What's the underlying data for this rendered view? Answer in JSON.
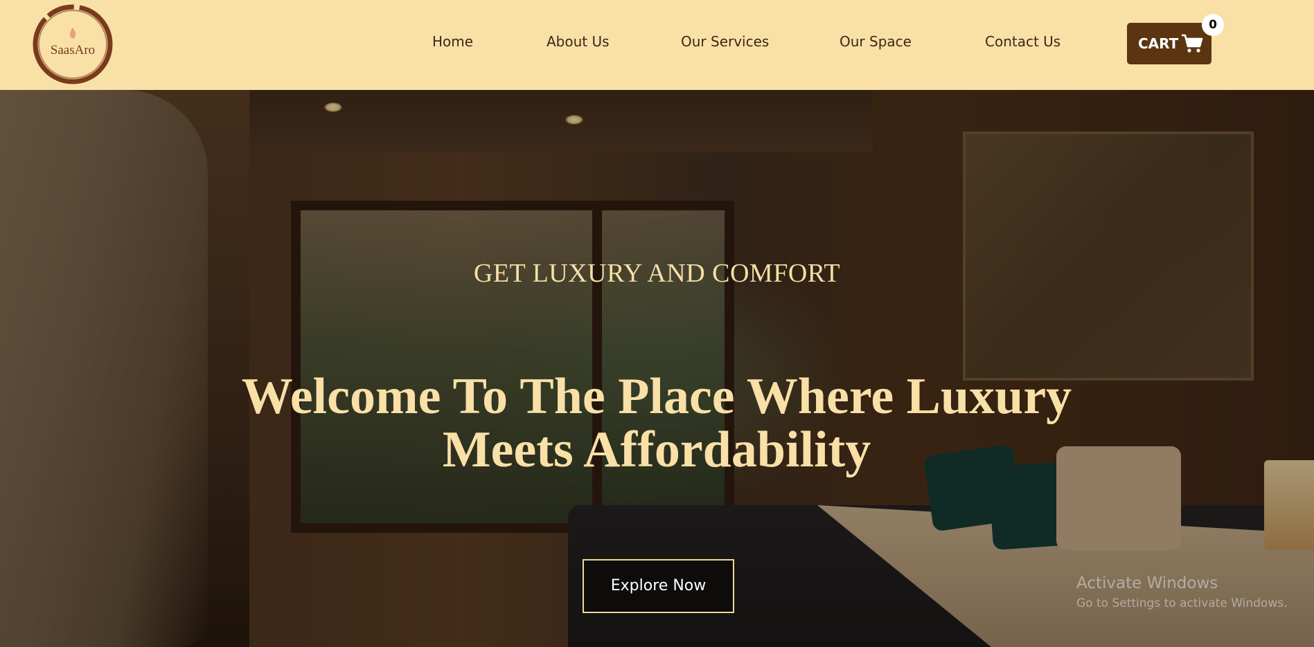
{
  "brand": {
    "logo_text": "SaasAro"
  },
  "nav": {
    "items": [
      {
        "label": "Home"
      },
      {
        "label": "About Us"
      },
      {
        "label": "Our Services"
      },
      {
        "label": "Our Space"
      },
      {
        "label": "Contact Us"
      }
    ]
  },
  "cart": {
    "label": "CART",
    "count": "0"
  },
  "hero": {
    "eyebrow": "GET LUXURY AND COMFORT",
    "headline": "Welcome To The Place Where Luxury Meets Affordability",
    "cta_label": "Explore Now"
  },
  "watermark": {
    "title": "Activate Windows",
    "subtitle": "Go to Settings to activate Windows."
  },
  "colors": {
    "header_bg": "#f9e0a7",
    "accent": "#5a3510",
    "headline": "#f9e0a7",
    "logo": "#7a3a1c"
  },
  "icons": {
    "cart": "shopping-cart-icon",
    "logo": "flame-ring-logo"
  }
}
